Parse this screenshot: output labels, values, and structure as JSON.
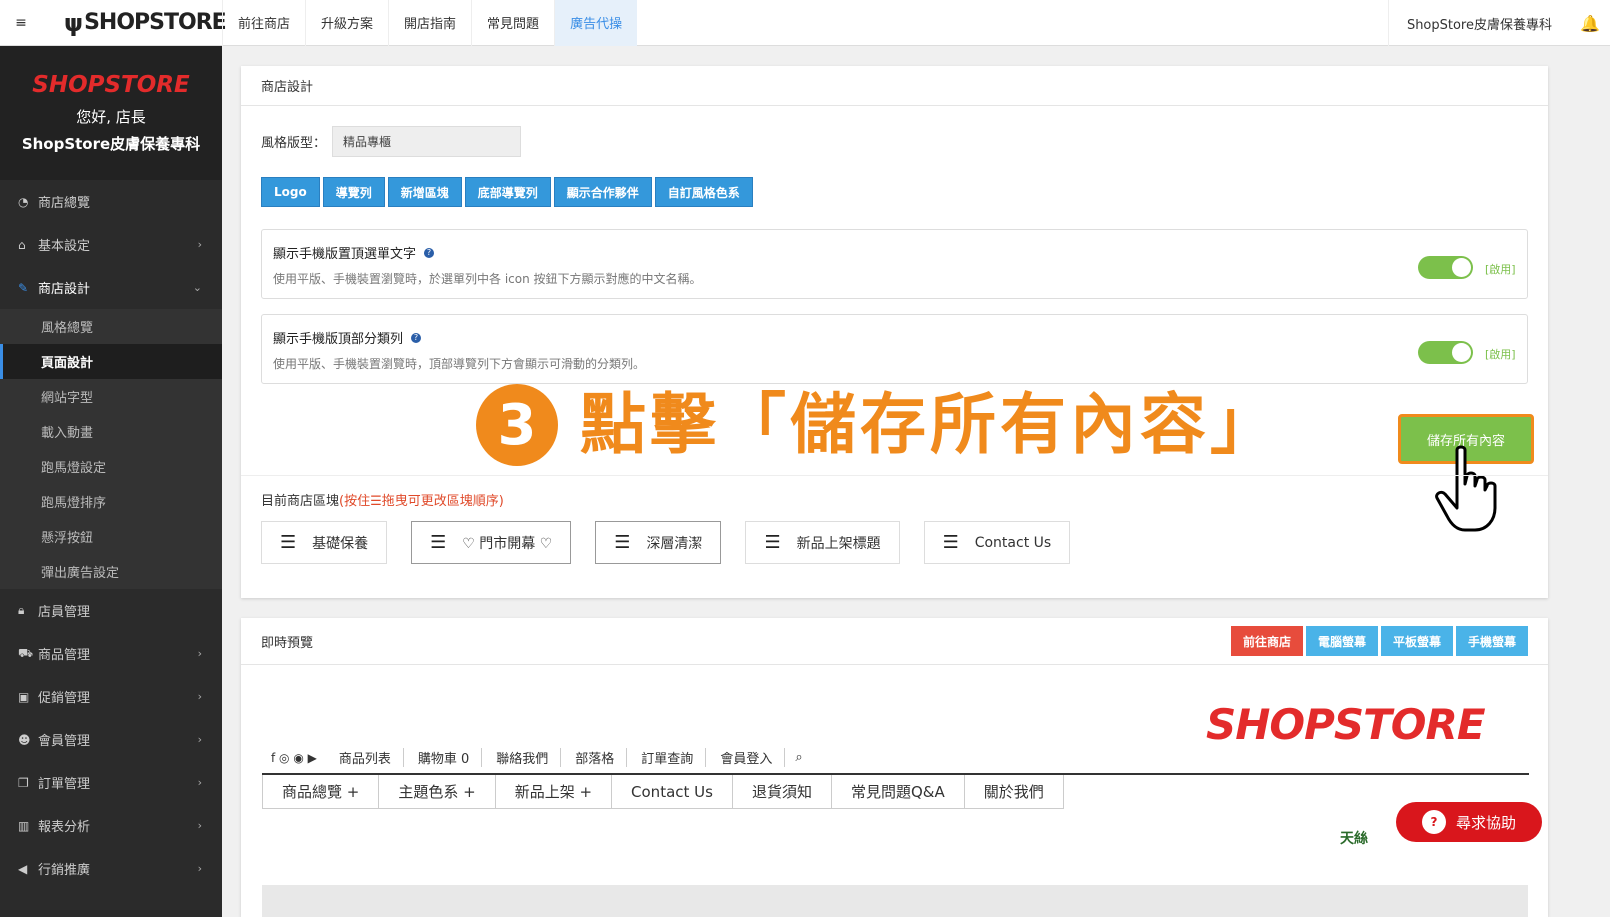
{
  "topbar": {
    "toggle_icon": "≡",
    "brand": "SHOPSTORE",
    "nav": [
      "前往商店",
      "升級方案",
      "開店指南",
      "常見問題",
      "廣告代操"
    ],
    "active_nav": "廣告代操",
    "shop_name": "ShopStore皮膚保養專科"
  },
  "sidebar": {
    "logo": "SHOPSTORE",
    "greeting": "您好, 店長",
    "shop_name": "ShopStore皮膚保養專科",
    "items": [
      {
        "label": "商店總覽",
        "icon": "dashboard-icon"
      },
      {
        "label": "基本設定",
        "icon": "bank-icon"
      },
      {
        "label": "商店設計",
        "icon": "wand-icon"
      },
      {
        "label": "店員管理",
        "icon": "lock-icon"
      },
      {
        "label": "商品管理",
        "icon": "cart-icon"
      },
      {
        "label": "促銷管理",
        "icon": "gift-icon"
      },
      {
        "label": "會員管理",
        "icon": "users-icon"
      },
      {
        "label": "訂單管理",
        "icon": "copy-icon"
      },
      {
        "label": "報表分析",
        "icon": "chart-icon"
      },
      {
        "label": "行銷推廣",
        "icon": "megaphone-icon"
      }
    ],
    "subitems": [
      "風格總覽",
      "頁面設計",
      "網站字型",
      "載入動畫",
      "跑馬燈設定",
      "跑馬燈排序",
      "懸浮按鈕",
      "彈出廣告設定"
    ],
    "active_subitem": "頁面設計"
  },
  "design_panel": {
    "title": "商店設計",
    "style_label": "風格版型：",
    "style_value": "精品專櫃",
    "buttons": [
      "Logo",
      "導覽列",
      "新增區塊",
      "底部導覽列",
      "顯示合作夥伴",
      "自訂風格色系"
    ],
    "settings": [
      {
        "title": "顯示手機版置頂選單文字",
        "desc": "使用平版、手機裝置瀏覽時，於選單列中各 icon 按鈕下方顯示對應的中文名稱。",
        "state": "[啟用]"
      },
      {
        "title": "顯示手機版頂部分類列",
        "desc": "使用平版、手機裝置瀏覽時，頂部導覽列下方會顯示可滑動的分類列。",
        "state": "[啟用]"
      }
    ],
    "annotation_number": "3",
    "annotation_text": "點擊「儲存所有內容」",
    "save_button": "儲存所有內容",
    "blocks_label": "目前商店區塊",
    "blocks_hint": "(按住☰拖曳可更改區塊順序)",
    "blocks": [
      "基礎保養",
      "♡ 門市開幕 ♡",
      "深層清潔",
      "新品上架標題",
      "Contact Us"
    ]
  },
  "preview_panel": {
    "title": "即時預覽",
    "buttons": [
      "前往商店",
      "電腦螢幕",
      "平板螢幕",
      "手機螢幕"
    ],
    "logo": "SHOPSTORE",
    "social_icons": "f ◎ ◉ ▶",
    "mini_nav": [
      "商品列表",
      "購物車 0",
      "聯絡我們",
      "部落格",
      "訂單查詢",
      "會員登入"
    ],
    "search_icon": "⌕",
    "main_menu": [
      "商品總覽 +",
      "主題色系 +",
      "新品上架 +",
      "Contact Us",
      "退貨須知",
      "常見問題Q&A",
      "關於我們"
    ],
    "ticker": "天絲"
  },
  "help_button": "尋求協助",
  "colors": {
    "accent_orange": "#f08a1c",
    "toggle_green": "#7cc04b",
    "brand_red": "#e32b2b",
    "button_blue": "#3498db"
  }
}
